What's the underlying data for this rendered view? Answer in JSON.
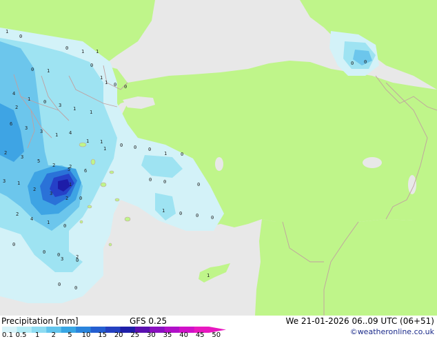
{
  "map": {
    "colors": {
      "land": "#bff58a",
      "sea": "#e8e8e8",
      "border": "#c0a0a0",
      "precip_light": "#d3f2f8",
      "precip_1": "#9ee3f2",
      "precip_2": "#6cc6ec",
      "precip_5": "#3ea4e4",
      "precip_10": "#2a72d8",
      "precip_15": "#2540c8",
      "precip_20": "#1d1ca8"
    },
    "station_values": [
      "0",
      "1",
      "0",
      "1",
      "1",
      "0",
      "1",
      "0",
      "0",
      "1",
      "0",
      "1",
      "4",
      "2",
      "1",
      "0",
      "3",
      "1",
      "1",
      "6",
      "3",
      "3",
      "1",
      "4",
      "1",
      "2",
      "3",
      "5",
      "2",
      "2",
      "6",
      "1",
      "1",
      "0",
      "0",
      "0",
      "3",
      "1",
      "2",
      "3",
      "2",
      "0",
      "5",
      "1",
      "2",
      "4",
      "1",
      "0",
      "0",
      "0",
      "0",
      "0",
      "0",
      "0",
      "1",
      "0",
      "0",
      "0",
      "1",
      "0",
      "3",
      "2",
      "0",
      "0",
      "1",
      "0",
      "0",
      "0"
    ]
  },
  "footer": {
    "title": "Precipitation [mm]",
    "model": "GFS 0.25",
    "datetime": "We 21-01-2026 06..09 UTC (06+51)",
    "credit": "©weatheronline.co.uk",
    "scale": {
      "labels": [
        "0.1",
        "0.5",
        "1",
        "2",
        "5",
        "10",
        "15",
        "20",
        "25",
        "30",
        "35",
        "40",
        "45",
        "50"
      ],
      "colors": [
        "#d8f4fa",
        "#b4ecf6",
        "#8edcf2",
        "#62c4ec",
        "#38a6e4",
        "#2a84dc",
        "#245ed0",
        "#2440c0",
        "#1e1ea8",
        "#5a10b0",
        "#8a10c0",
        "#b010c8",
        "#d010c8",
        "#e818c0"
      ]
    }
  }
}
